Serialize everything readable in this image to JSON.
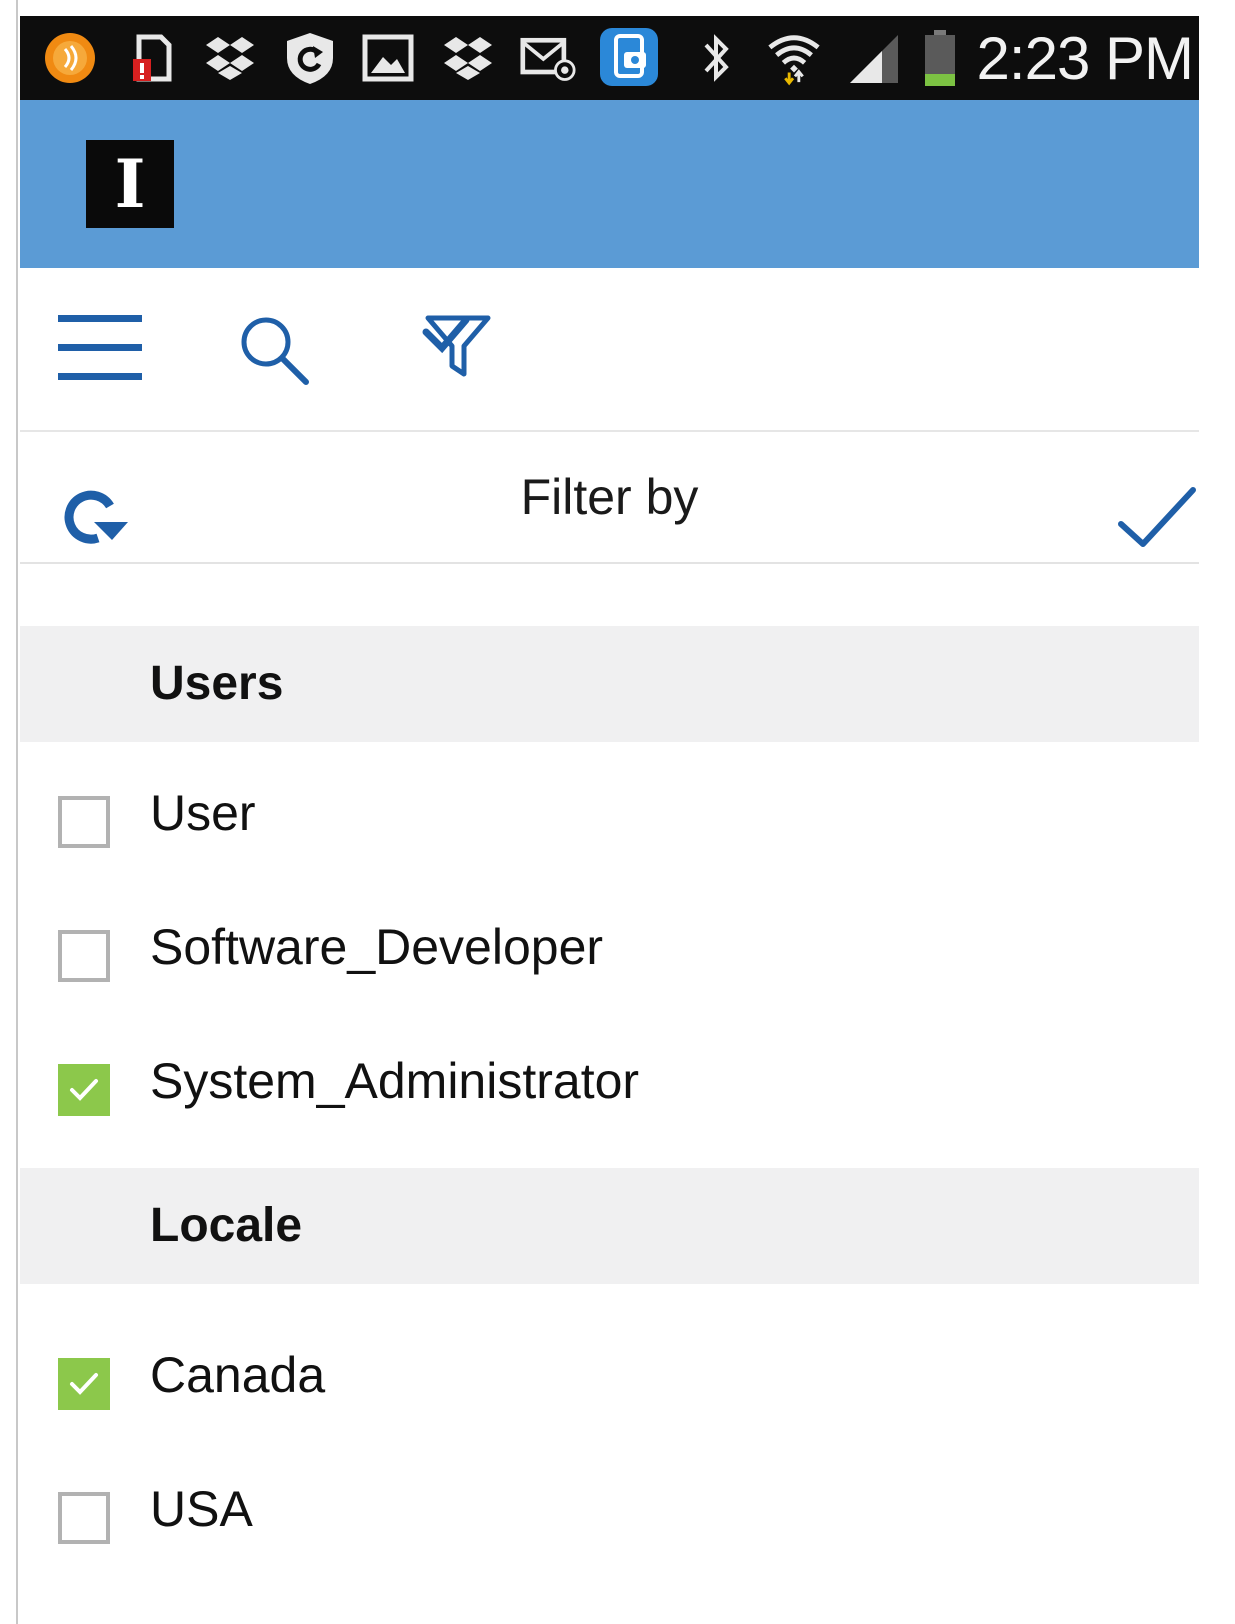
{
  "status_bar": {
    "time": "2:23 PM",
    "icons": [
      "nfc-icon",
      "sim-alert-icon",
      "dropbox-icon",
      "shield-icon",
      "gallery-icon",
      "dropbox-icon",
      "email-icon",
      "screenshot-app-icon",
      "bluetooth-icon",
      "wifi-icon",
      "signal-icon",
      "battery-icon"
    ]
  },
  "app_bar": {
    "logo_letter": "I",
    "color": "#5b9bd5"
  },
  "toolbar": {
    "icons": [
      "menu-icon",
      "search-icon",
      "filter-check-icon"
    ]
  },
  "filter": {
    "title": "Filter by"
  },
  "sections": [
    {
      "title": "Users",
      "items": [
        {
          "label": "User",
          "checked": false
        },
        {
          "label": "Software_Developer",
          "checked": false
        },
        {
          "label": "System_Administrator",
          "checked": true
        }
      ]
    },
    {
      "title": "Locale",
      "items": [
        {
          "label": "Canada",
          "checked": true
        },
        {
          "label": "USA",
          "checked": false
        }
      ]
    }
  ],
  "colors": {
    "accent_blue": "#1f5fa8",
    "check_green": "#8cc84b",
    "section_bg": "#f0f0f1"
  }
}
